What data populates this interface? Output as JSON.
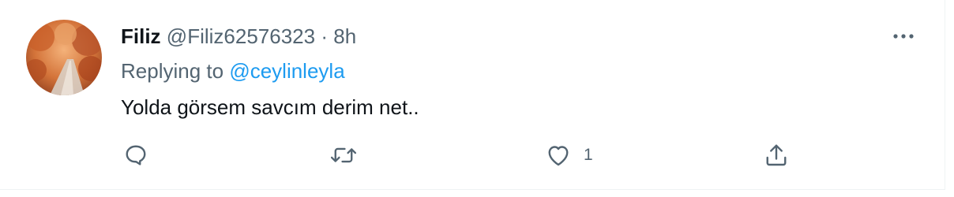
{
  "tweet": {
    "display_name": "Filiz",
    "handle": "@Filiz62576323",
    "separator": "·",
    "time": "8h",
    "reply_prefix": "Replying to",
    "reply_to": "@ceylinleyla",
    "text": "Yolda görsem savcım derim net..",
    "like_count": "1"
  },
  "icons": {
    "more": "more-horizontal-icon",
    "reply": "reply-bubble-icon",
    "retweet": "retweet-icon",
    "like": "heart-icon",
    "share": "share-icon"
  },
  "colors": {
    "text_primary": "#0f1419",
    "text_secondary": "#536471",
    "link": "#1d9bf0",
    "border": "#eff3f4"
  }
}
